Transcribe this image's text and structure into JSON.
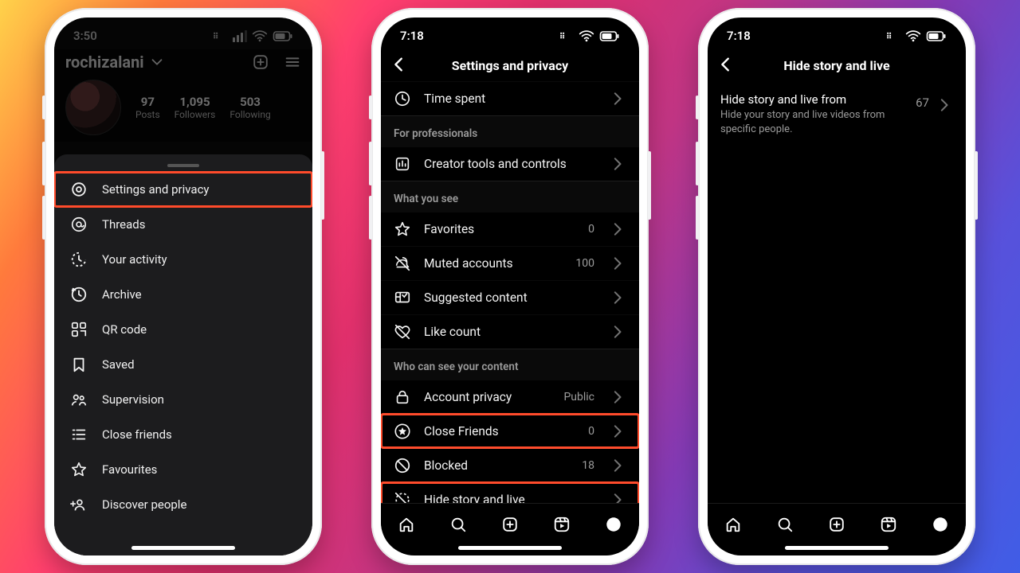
{
  "phone1": {
    "time": "3:50",
    "username": "rochizalani",
    "stats": {
      "posts_n": "97",
      "posts_l": "Posts",
      "followers_n": "1,095",
      "followers_l": "Followers",
      "following_n": "503",
      "following_l": "Following"
    },
    "menu": [
      {
        "id": "settings",
        "label": "Settings and privacy",
        "hl": true
      },
      {
        "id": "threads",
        "label": "Threads"
      },
      {
        "id": "activity",
        "label": "Your activity"
      },
      {
        "id": "archive",
        "label": "Archive"
      },
      {
        "id": "qr",
        "label": "QR code"
      },
      {
        "id": "saved",
        "label": "Saved"
      },
      {
        "id": "supervision",
        "label": "Supervision"
      },
      {
        "id": "closefriends",
        "label": "Close friends"
      },
      {
        "id": "favourites",
        "label": "Favourites"
      },
      {
        "id": "discover",
        "label": "Discover people"
      }
    ]
  },
  "phone2": {
    "time": "7:18",
    "title": "Settings and privacy",
    "groups": [
      {
        "header": null,
        "rows": [
          {
            "id": "timespent",
            "label": "Time spent"
          }
        ]
      },
      {
        "header": "For professionals",
        "rows": [
          {
            "id": "creator",
            "label": "Creator tools and controls"
          }
        ]
      },
      {
        "header": "What you see",
        "rows": [
          {
            "id": "favorites",
            "label": "Favorites",
            "val": "0"
          },
          {
            "id": "muted",
            "label": "Muted accounts",
            "val": "100"
          },
          {
            "id": "suggested",
            "label": "Suggested content"
          },
          {
            "id": "likecount",
            "label": "Like count"
          }
        ]
      },
      {
        "header": "Who can see your content",
        "rows": [
          {
            "id": "privacy",
            "label": "Account privacy",
            "val": "Public"
          },
          {
            "id": "close",
            "label": "Close Friends",
            "val": "0",
            "hl": true
          },
          {
            "id": "blocked",
            "label": "Blocked",
            "val": "18"
          },
          {
            "id": "hide",
            "label": "Hide story and live",
            "hl": true
          }
        ]
      }
    ]
  },
  "phone3": {
    "time": "7:18",
    "title": "Hide story and live",
    "row": {
      "title": "Hide story and live from",
      "sub": "Hide your story and live videos from specific people.",
      "count": "67"
    }
  }
}
